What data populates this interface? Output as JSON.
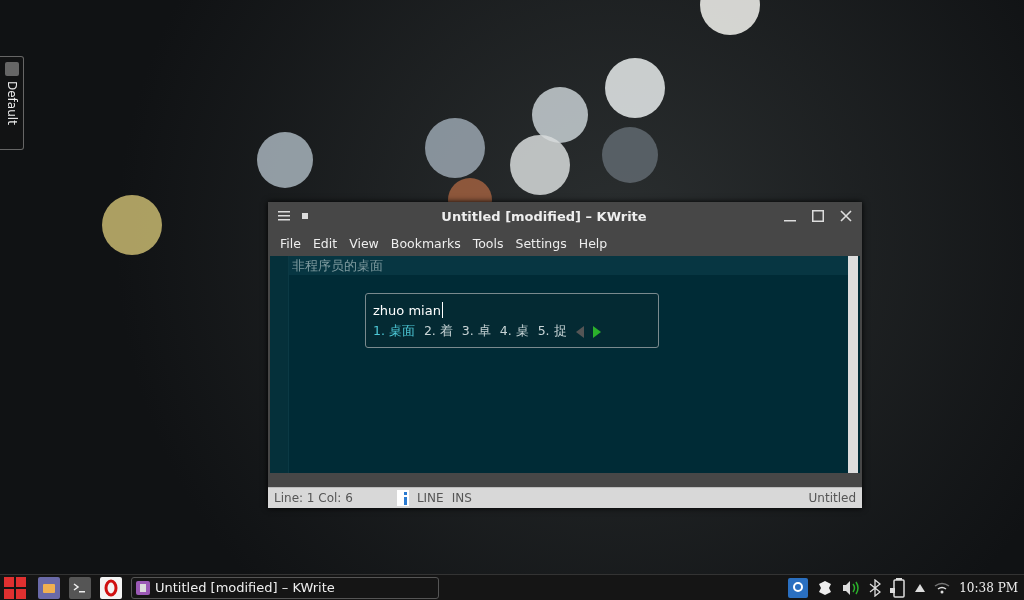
{
  "side_panel": {
    "label": "Default"
  },
  "window": {
    "title": "Untitled [modified] – KWrite",
    "menu": [
      "File",
      "Edit",
      "View",
      "Bookmarks",
      "Tools",
      "Settings",
      "Help"
    ],
    "editor": {
      "lines": [
        "非程序员的桌面"
      ]
    },
    "ime": {
      "preedit": "zhuo mian",
      "candidates": [
        {
          "index": "1.",
          "text": "桌面",
          "selected": true
        },
        {
          "index": "2.",
          "text": "着",
          "selected": false
        },
        {
          "index": "3.",
          "text": "卓",
          "selected": false
        },
        {
          "index": "4.",
          "text": "桌",
          "selected": false
        },
        {
          "index": "5.",
          "text": "捉",
          "selected": false
        }
      ]
    },
    "status_bar": {
      "position": "Line: 1 Col: 6",
      "mode": "LINE",
      "input_mode": "INS",
      "document": "Untitled"
    }
  },
  "taskbar": {
    "window_button": "Untitled [modified] – KWrite",
    "clock": "10:38 PM"
  }
}
